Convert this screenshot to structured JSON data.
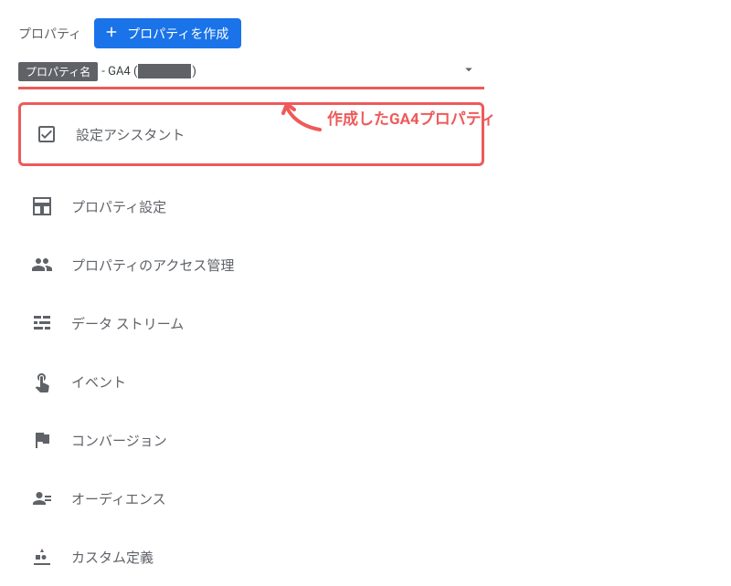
{
  "header": {
    "section_label": "プロパティ",
    "create_button": "プロパティを作成"
  },
  "selector": {
    "badge_label": "プロパティ名",
    "name_suffix": " - GA4 (",
    "name_close": ")"
  },
  "annotation": {
    "text": "作成したGA4プロパティ"
  },
  "menu": {
    "items": [
      {
        "label": "設定アシスタント",
        "icon": "checkbox-icon",
        "selected": true
      },
      {
        "label": "プロパティ設定",
        "icon": "layout-icon"
      },
      {
        "label": "プロパティのアクセス管理",
        "icon": "group-icon"
      },
      {
        "label": "データ ストリーム",
        "icon": "stream-icon"
      },
      {
        "label": "イベント",
        "icon": "tap-icon"
      },
      {
        "label": "コンバージョン",
        "icon": "flag-icon"
      },
      {
        "label": "オーディエンス",
        "icon": "audience-icon"
      },
      {
        "label": "カスタム定義",
        "icon": "custom-icon"
      }
    ]
  },
  "colors": {
    "highlight": "#ee5a5a",
    "primary": "#1a73e8",
    "muted": "#5f6368"
  }
}
